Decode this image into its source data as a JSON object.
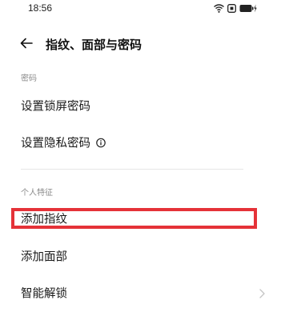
{
  "status_bar": {
    "time": "18:56",
    "icons": [
      "wifi-icon",
      "nfc-icon",
      "battery-charging-icon"
    ]
  },
  "header": {
    "back_icon": "arrow-left-icon",
    "title": "指纹、面部与密码"
  },
  "sections": [
    {
      "label": "密码",
      "items": [
        {
          "label": "设置锁屏密码"
        },
        {
          "label": "设置隐私密码",
          "icon": "info-icon"
        }
      ]
    },
    {
      "label": "个人特征",
      "items": [
        {
          "label": "添加指纹",
          "highlighted": true
        },
        {
          "label": "添加面部"
        },
        {
          "label": "智能解锁",
          "icon": "chevron-right-icon"
        }
      ]
    }
  ],
  "colors": {
    "highlight": "#e53238",
    "section_label": "#8a8a8a",
    "divider": "#e7e7e7"
  }
}
